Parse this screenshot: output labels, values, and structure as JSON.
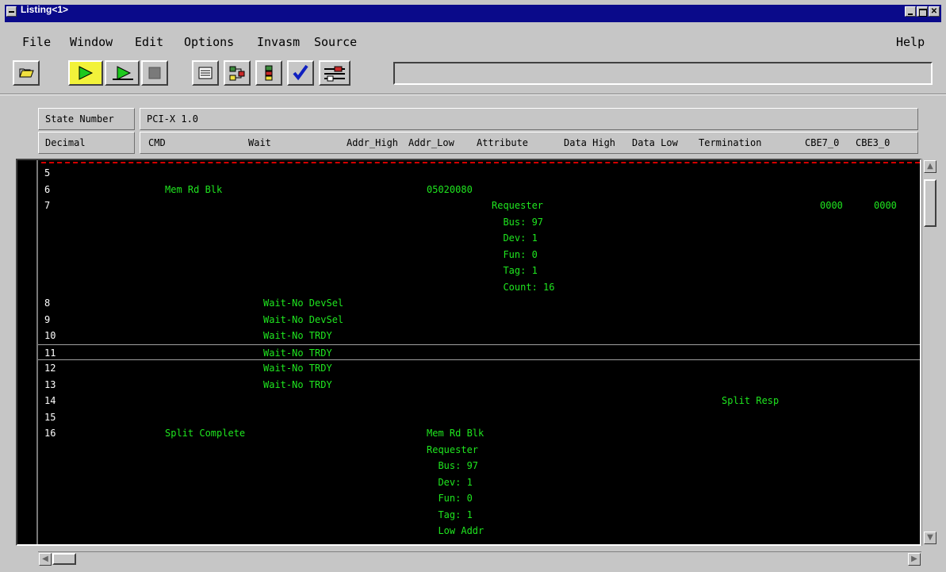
{
  "window": {
    "title": "Listing<1>"
  },
  "menu": [
    "File",
    "Window",
    "Edit",
    "Options",
    "Invasm",
    "Source",
    "Help"
  ],
  "toolbar_icons": [
    "open-icon",
    "run-icon",
    "run-repetitive-icon",
    "stop-icon",
    "listing-icon",
    "navigation-icon",
    "marker-icon",
    "check-icon",
    "setup-icon"
  ],
  "colors": {
    "trace_text": "#1fe61f",
    "state_text": "#ffffff",
    "title_bar": "#0a0a8a",
    "listing_bg": "#000000"
  },
  "headers": {
    "state_number": "State Number",
    "decimal": "Decimal",
    "module": "PCI-X 1.0",
    "columns": [
      "CMD",
      "Wait",
      "Addr_High",
      "Addr_Low",
      "Attribute",
      "Data High",
      "Data Low",
      "Termination",
      "CBE7_0",
      "CBE3_0"
    ]
  },
  "rows": [
    {
      "state": "5",
      "cmd": "",
      "wait": "",
      "addr": "",
      "attr": "",
      "term": "",
      "cbe7": "",
      "cbe3": ""
    },
    {
      "state": "6",
      "cmd": "Mem Rd Blk",
      "wait": "",
      "addr": "05020080",
      "attr": "",
      "term": "",
      "cbe7": "",
      "cbe3": ""
    },
    {
      "state": "7",
      "cmd": "",
      "wait": "",
      "addr": "",
      "attr": "Requester",
      "term": "",
      "cbe7": "0000",
      "cbe3": "0000"
    },
    {
      "state": "",
      "cmd": "",
      "wait": "",
      "addr": "",
      "attr": "  Bus: 97",
      "term": "",
      "cbe7": "",
      "cbe3": ""
    },
    {
      "state": "",
      "cmd": "",
      "wait": "",
      "addr": "",
      "attr": "  Dev: 1",
      "term": "",
      "cbe7": "",
      "cbe3": ""
    },
    {
      "state": "",
      "cmd": "",
      "wait": "",
      "addr": "",
      "attr": "  Fun: 0",
      "term": "",
      "cbe7": "",
      "cbe3": ""
    },
    {
      "state": "",
      "cmd": "",
      "wait": "",
      "addr": "",
      "attr": "  Tag: 1",
      "term": "",
      "cbe7": "",
      "cbe3": ""
    },
    {
      "state": "",
      "cmd": "",
      "wait": "",
      "addr": "",
      "attr": "  Count: 16",
      "term": "",
      "cbe7": "",
      "cbe3": ""
    },
    {
      "state": "8",
      "cmd": "",
      "wait": "Wait-No DevSel",
      "addr": "",
      "attr": "",
      "term": "",
      "cbe7": "",
      "cbe3": ""
    },
    {
      "state": "9",
      "cmd": "",
      "wait": "Wait-No DevSel",
      "addr": "",
      "attr": "",
      "term": "",
      "cbe7": "",
      "cbe3": ""
    },
    {
      "state": "10",
      "cmd": "",
      "wait": "Wait-No TRDY",
      "addr": "",
      "attr": "",
      "term": "",
      "cbe7": "",
      "cbe3": ""
    },
    {
      "state": "11",
      "cmd": "",
      "wait": "Wait-No TRDY",
      "addr": "",
      "attr": "",
      "term": "",
      "cbe7": "",
      "cbe3": "",
      "selected": true
    },
    {
      "state": "12",
      "cmd": "",
      "wait": "Wait-No TRDY",
      "addr": "",
      "attr": "",
      "term": "",
      "cbe7": "",
      "cbe3": ""
    },
    {
      "state": "13",
      "cmd": "",
      "wait": "Wait-No TRDY",
      "addr": "",
      "attr": "",
      "term": "",
      "cbe7": "",
      "cbe3": ""
    },
    {
      "state": "14",
      "cmd": "",
      "wait": "",
      "addr": "",
      "attr": "",
      "term": "Split Resp",
      "cbe7": "",
      "cbe3": ""
    },
    {
      "state": "15",
      "cmd": "",
      "wait": "",
      "addr": "",
      "attr": "",
      "term": "",
      "cbe7": "",
      "cbe3": ""
    },
    {
      "state": "16",
      "cmd": "Split Complete",
      "wait": "",
      "addr": "Mem Rd Blk",
      "attr": "",
      "term": "",
      "cbe7": "",
      "cbe3": ""
    },
    {
      "state": "",
      "cmd": "",
      "wait": "",
      "addr": "Requester",
      "attr": "",
      "term": "",
      "cbe7": "",
      "cbe3": ""
    },
    {
      "state": "",
      "cmd": "",
      "wait": "",
      "addr": "  Bus: 97",
      "attr": "",
      "term": "",
      "cbe7": "",
      "cbe3": ""
    },
    {
      "state": "",
      "cmd": "",
      "wait": "",
      "addr": "  Dev: 1",
      "attr": "",
      "term": "",
      "cbe7": "",
      "cbe3": ""
    },
    {
      "state": "",
      "cmd": "",
      "wait": "",
      "addr": "  Fun: 0",
      "attr": "",
      "term": "",
      "cbe7": "",
      "cbe3": ""
    },
    {
      "state": "",
      "cmd": "",
      "wait": "",
      "addr": "  Tag: 1",
      "attr": "",
      "term": "",
      "cbe7": "",
      "cbe3": ""
    },
    {
      "state": "",
      "cmd": "",
      "wait": "",
      "addr": "  Low Addr",
      "attr": "",
      "term": "",
      "cbe7": "",
      "cbe3": ""
    }
  ]
}
